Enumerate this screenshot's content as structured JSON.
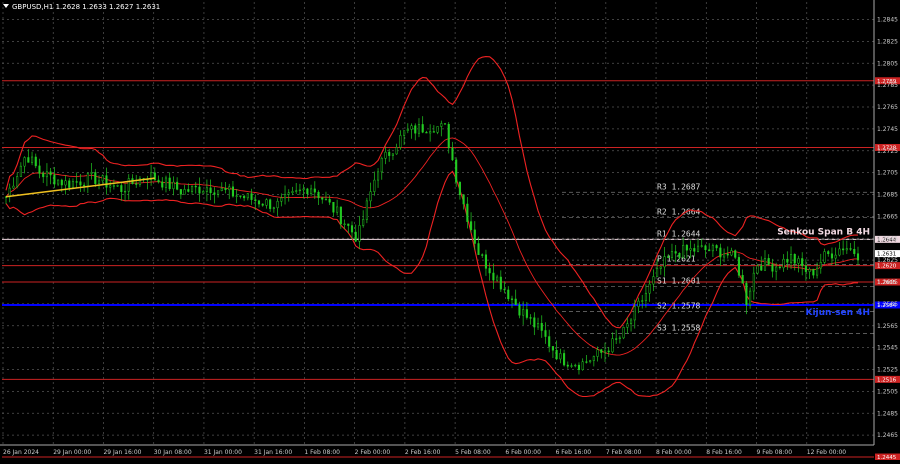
{
  "header": {
    "title": "GBPUSD,H1  1.2628 1.2633 1.2627 1.2631",
    "icon": "triangle-down-icon"
  },
  "chart_data": {
    "type": "candlestick",
    "symbol": "GBPUSD",
    "timeframe": "H1",
    "ohlc_readout": {
      "open": 1.2628,
      "high": 1.2633,
      "low": 1.2627,
      "close": 1.2631
    },
    "ylim": [
      1.2456,
      1.2861
    ],
    "y_ticks": [
      "1.2845",
      "1.2825",
      "1.2805",
      "1.2785",
      "1.2765",
      "1.2745",
      "1.2725",
      "1.2705",
      "1.2685",
      "1.2665",
      "1.2645",
      "1.2625",
      "1.2605",
      "1.2585",
      "1.2565",
      "1.2545",
      "1.2525",
      "1.2505",
      "1.2485",
      "1.2465"
    ],
    "x_ticks": [
      "26 Jan 2024",
      "29 Jan 00:00",
      "29 Jan 16:00",
      "30 Jan 08:00",
      "31 Jan 00:00",
      "31 Jan 16:00",
      "1 Feb 08:00",
      "2 Feb 00:00",
      "2 Feb 16:00",
      "5 Feb 08:00",
      "6 Feb 00:00",
      "6 Feb 16:00",
      "7 Feb 08:00",
      "8 Feb 00:00",
      "8 Feb 16:00",
      "9 Feb 08:00",
      "12 Feb 00:00"
    ],
    "grid": true,
    "horizontal_levels": [
      {
        "value": 1.2789,
        "label": "1.2789",
        "color": "#cc2222"
      },
      {
        "value": 1.2728,
        "label": "1.2728",
        "color": "#cc2222"
      },
      {
        "value": 1.2644,
        "label": "1.2644",
        "color": "#f0d8e0"
      },
      {
        "value": 1.262,
        "label": "1.2620",
        "color": "#cc2222"
      },
      {
        "value": 1.2605,
        "label": "1.2605",
        "color": "#cc2222"
      },
      {
        "value": 1.2584,
        "label": "1.2584",
        "color": "#0000ff"
      },
      {
        "value": 1.2516,
        "label": "1.2516",
        "color": "#cc2222"
      },
      {
        "value": 1.2445,
        "label": "1.2445",
        "color": "#cc2222"
      }
    ],
    "pivots": [
      {
        "name": "R3",
        "value": "1.2687"
      },
      {
        "name": "R2",
        "value": "1.2664"
      },
      {
        "name": "R1",
        "value": "1.2644"
      },
      {
        "name": "P",
        "value": "1.2621"
      },
      {
        "name": "S1",
        "value": "1.2601"
      },
      {
        "name": "S2",
        "value": "1.2578"
      },
      {
        "name": "S3",
        "value": "1.2558"
      }
    ],
    "annotations": [
      {
        "text": "Senkou Span B 4H",
        "color": "#f0d8e0"
      },
      {
        "text": "Kijun-sen 4H",
        "color": "#2244ff"
      }
    ],
    "current_price": "1.2631",
    "colors": {
      "candles": "#22cc22",
      "bands": "#ee2222",
      "trend": "#f0c020",
      "grid": "#555555"
    }
  }
}
